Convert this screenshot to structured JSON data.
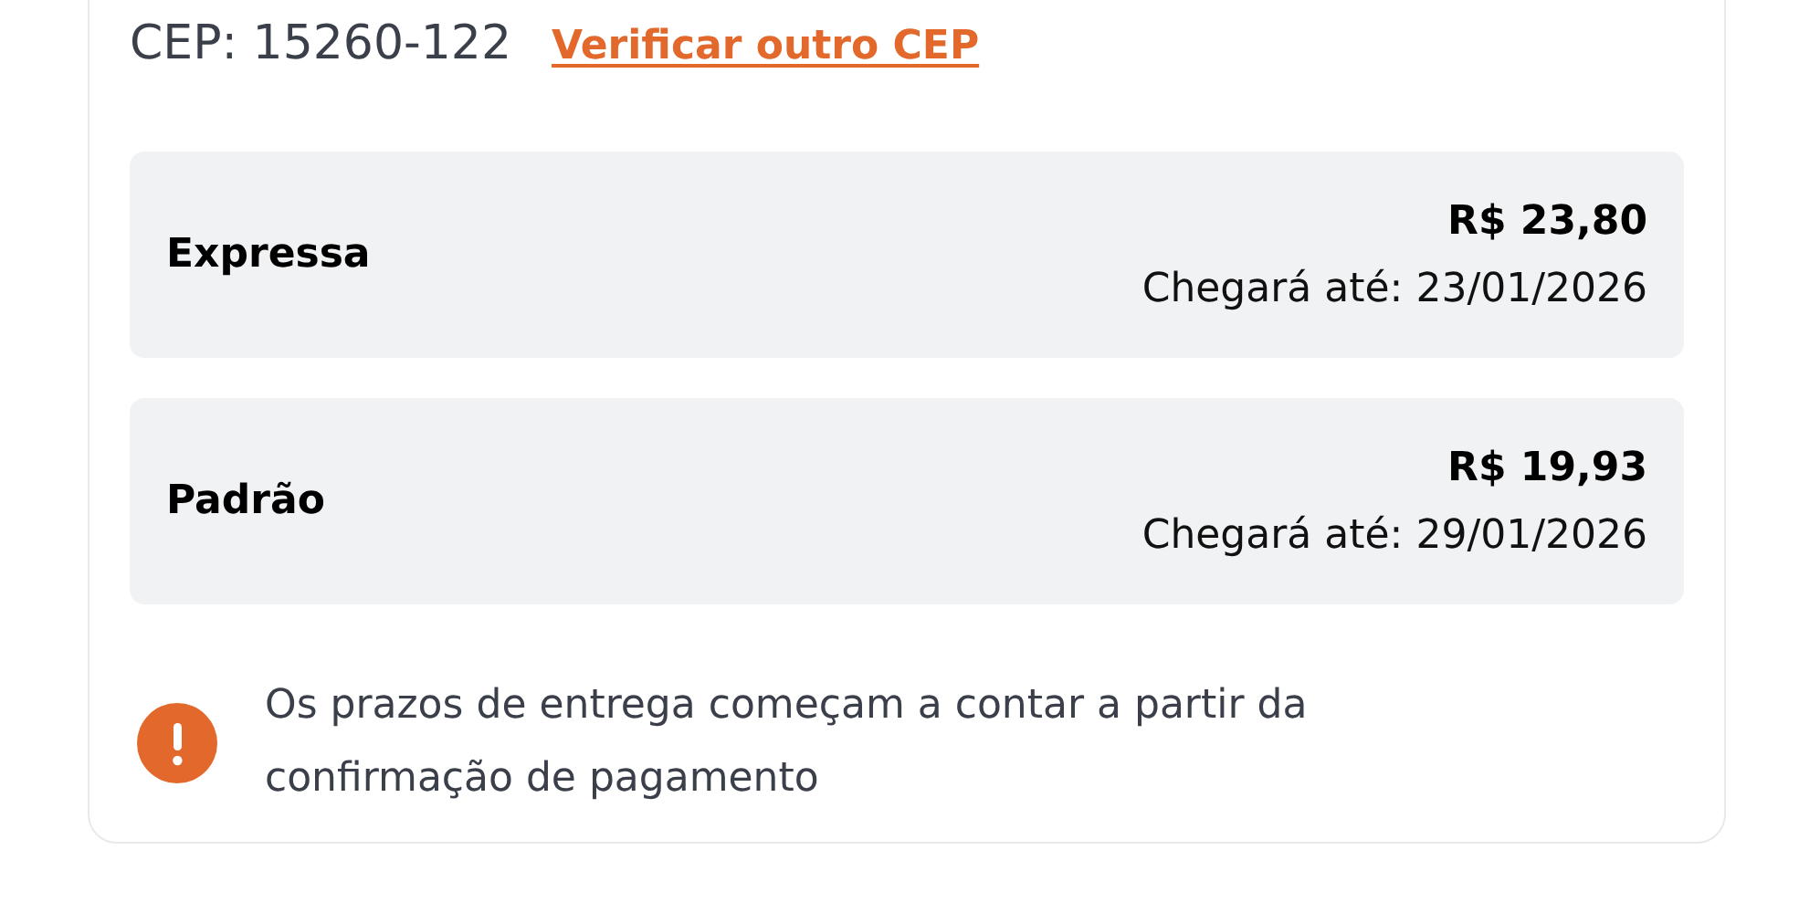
{
  "cep": {
    "label": "CEP: 15260-122",
    "link": "Verificar outro CEP"
  },
  "options": [
    {
      "name": "Expressa",
      "price": "R$ 23,80",
      "arrival": "Chegará até: 23/01/2026"
    },
    {
      "name": "Padrão",
      "price": "R$ 19,93",
      "arrival": "Chegará até: 29/01/2026"
    }
  ],
  "notice": "Os prazos de entrega começam a contar a partir da confirmação de pagamento"
}
